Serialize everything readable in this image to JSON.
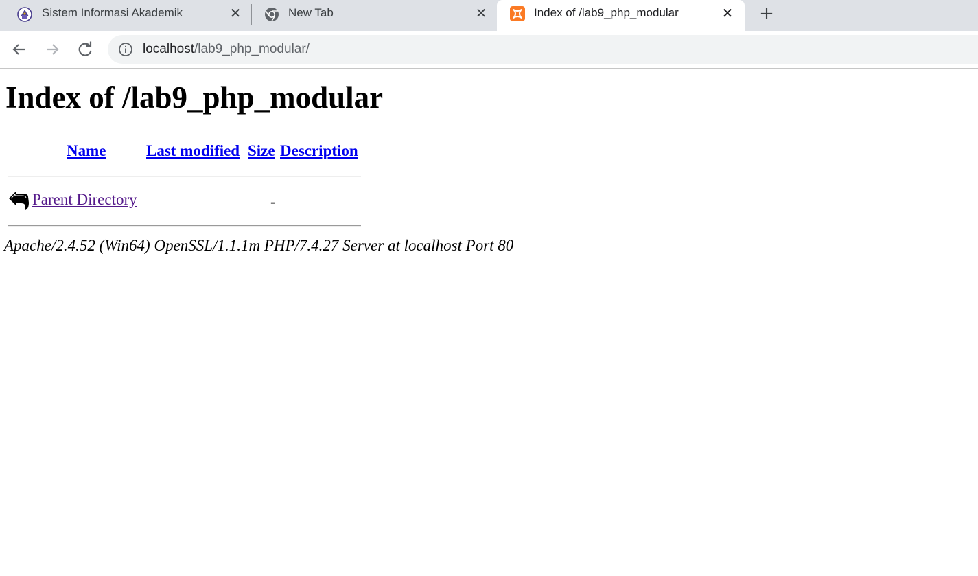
{
  "tabs": [
    {
      "title": "Sistem Informasi Akademik",
      "favicon": "university-crest-icon",
      "active": false
    },
    {
      "title": "New Tab",
      "favicon": "chrome-icon",
      "active": false
    },
    {
      "title": "Index of /lab9_php_modular",
      "favicon": "xampp-icon",
      "active": true
    }
  ],
  "new_tab_label": "+",
  "close_label": "✕",
  "address_bar": {
    "host": "localhost",
    "path": "/lab9_php_modular/"
  },
  "page": {
    "heading": "Index of /lab9_php_modular",
    "columns": {
      "name": "Name",
      "last_modified": "Last modified",
      "size": "Size",
      "description": "Description"
    },
    "rows": [
      {
        "name": "Parent Directory",
        "last_modified": "",
        "size": "-",
        "description": "",
        "icon": "back-arrow-icon"
      }
    ],
    "footer": "Apache/2.4.52 (Win64) OpenSSL/1.1.1m PHP/7.4.27 Server at localhost Port 80"
  },
  "colors": {
    "link": "#0000ee",
    "visited_link": "#551a8b",
    "xampp_orange": "#fb7a24",
    "tabstrip": "#dee1e6"
  }
}
